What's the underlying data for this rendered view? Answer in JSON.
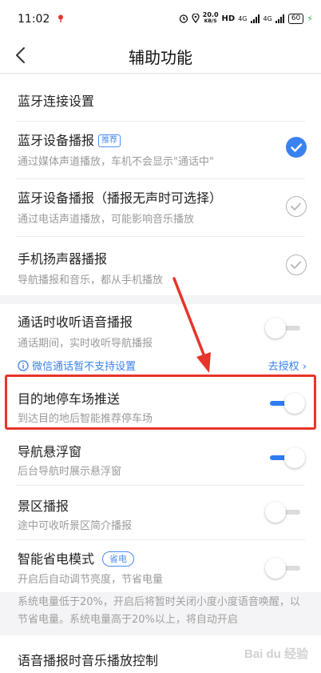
{
  "status_bar": {
    "time": "11:02",
    "speed_value": "20.0",
    "speed_unit": "KB/S",
    "hd": "HD",
    "signal1": "4G",
    "signal2": "4G",
    "battery": "60"
  },
  "header": {
    "title": "辅助功能"
  },
  "section_bluetooth": {
    "connect_title": "蓝牙连接设置",
    "items": [
      {
        "title": "蓝牙设备播报",
        "badge": "推荐",
        "subtitle": "通过媒体声道播放，车机不会显示\"通话中\"",
        "checked": true
      },
      {
        "title": "蓝牙设备播报（播报无声时可选择）",
        "subtitle": "通过电话声道播放，可能影响音乐播放",
        "checked": false
      },
      {
        "title": "手机扬声器播报",
        "subtitle": "导航播报和音乐，都从手机播放",
        "checked": false
      }
    ]
  },
  "section_features": {
    "items": [
      {
        "title": "通话时收听语音播报",
        "subtitle": "通话期间，实时收听导航播报",
        "toggle": false
      },
      {
        "title": "目的地停车场推送",
        "subtitle": "到达目的地后智能推荐停车场",
        "toggle": true
      },
      {
        "title": "导航悬浮窗",
        "subtitle": "后台导航时展示悬浮窗",
        "toggle": true
      },
      {
        "title": "景区播报",
        "subtitle": "途中可收听景区简介播报",
        "toggle": false
      },
      {
        "title": "智能省电模式",
        "badge": "省电",
        "subtitle": "开启后自动调节亮度，节省电量",
        "toggle": false
      }
    ],
    "wechat_notice": "微信通话暂不支持设置",
    "authorize_link": "去授权",
    "power_note": "系统电量低于20%，开启后将暂时关闭小度小度语音唤醒，以节省电量。系统电量高于20%以上，将自动开启"
  },
  "section_music": {
    "title": "语音播报时音乐播放控制"
  },
  "watermark": {
    "text": "Bai du 经验"
  },
  "colors": {
    "accent": "#3a82f0",
    "annotation": "#e8342b"
  }
}
